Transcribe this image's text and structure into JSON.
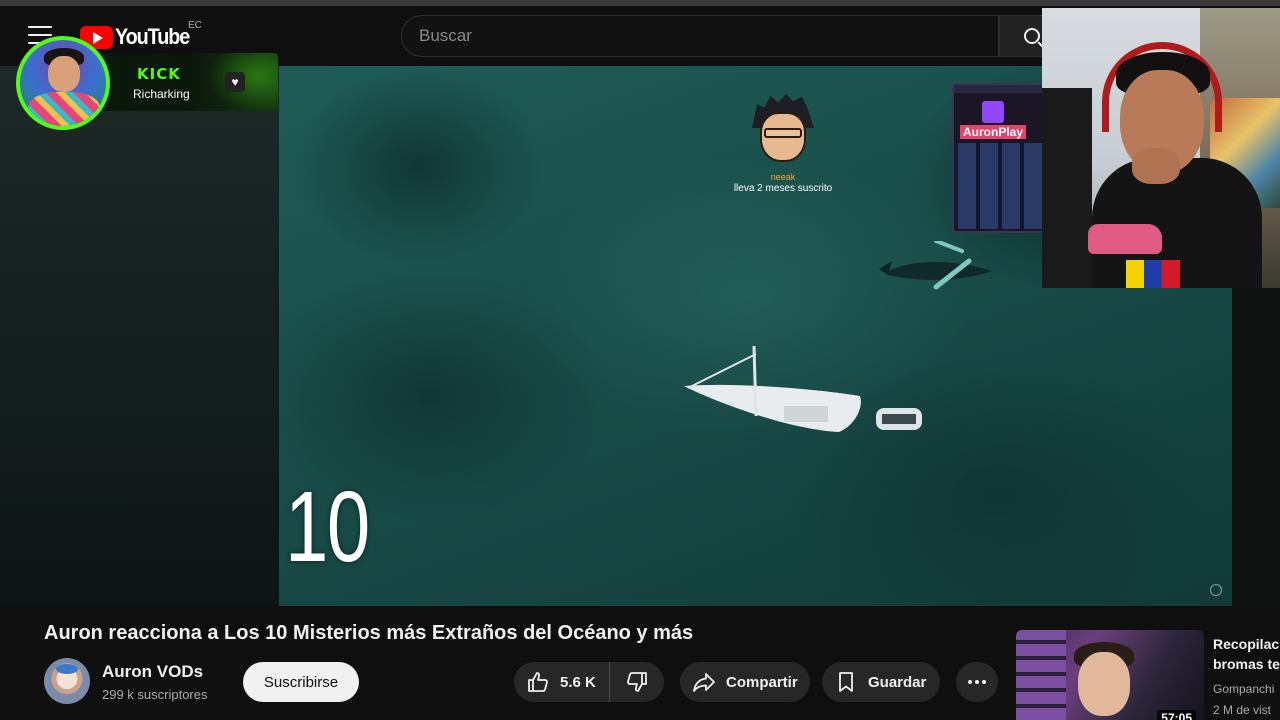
{
  "masthead": {
    "logo_text": "YouTube",
    "region": "EC",
    "search_placeholder": "Buscar"
  },
  "kick_overlay": {
    "brand": "KICK",
    "username": "Richarking",
    "brand_color": "#53fc18"
  },
  "video": {
    "countdown_number": "10",
    "sub_alert": {
      "name": "neeak",
      "message": "lleva 2 meses suscrito"
    },
    "twitch_inset": {
      "channel": "AuronPlay"
    }
  },
  "watch": {
    "title": "Auron reacciona a Los 10 Misterios más Extraños del Océano y más",
    "channel_name": "Auron VODs",
    "subscriber_count": "299 k suscriptores",
    "subscribe_label": "Suscribirse",
    "like_count": "5.6 K",
    "share_label": "Compartir",
    "save_label": "Guardar"
  },
  "recommendation": {
    "title_line1": "Recopilac",
    "title_line2": "bromas te",
    "channel": "Gompanchi",
    "views": "2 M de vist",
    "duration": "57:05"
  },
  "icons": [
    "menu-icon",
    "search-icon",
    "heart-icon",
    "like-icon",
    "dislike-icon",
    "share-icon",
    "save-icon",
    "more-icon"
  ],
  "colors": {
    "accent_red": "#ff0000",
    "kick_green": "#53fc18",
    "twitch_purple": "#9146ff",
    "subscribe_bg": "#f1f1f1"
  }
}
